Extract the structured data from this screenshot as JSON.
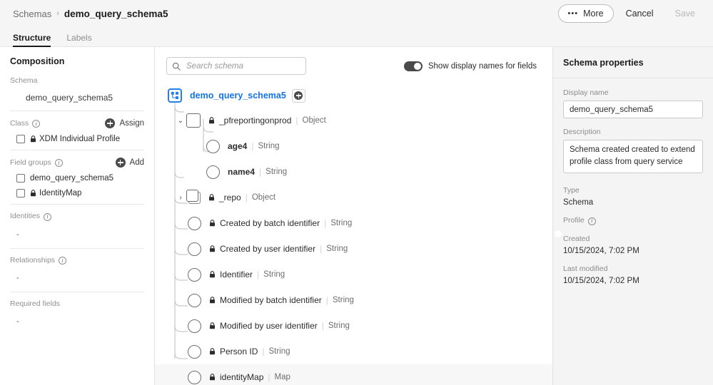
{
  "header": {
    "breadcrumb": {
      "root": "Schemas",
      "separator": "›",
      "current": "demo_query_schema5"
    },
    "more_label": "More",
    "cancel_label": "Cancel",
    "save_label": "Save"
  },
  "tabs": [
    {
      "label": "Structure",
      "active": true
    },
    {
      "label": "Labels",
      "active": false
    }
  ],
  "sidebar": {
    "title": "Composition",
    "schema": {
      "label": "Schema",
      "value": "demo_query_schema5"
    },
    "class": {
      "label": "Class",
      "action": "Assign",
      "items": [
        {
          "label": "XDM Individual Profile",
          "locked": true
        }
      ]
    },
    "field_groups": {
      "label": "Field groups",
      "action": "Add",
      "items": [
        {
          "label": "demo_query_schema5",
          "locked": false
        },
        {
          "label": "IdentityMap",
          "locked": true
        }
      ]
    },
    "identities": {
      "label": "Identities",
      "value": "-"
    },
    "relationships": {
      "label": "Relationships",
      "value": "-"
    },
    "required_fields": {
      "label": "Required fields",
      "value": "-"
    }
  },
  "center": {
    "search_placeholder": "Search schema",
    "search_value": "",
    "toggle_label": "Show display names for fields",
    "toggle_on": true,
    "root": {
      "name": "demo_query_schema5",
      "icon": "schema-root-icon"
    },
    "rows": [
      {
        "name": "_pfreportingonprod",
        "type": "Object",
        "node": "square",
        "indent": 1,
        "locked": true,
        "expanded": true,
        "chevron": "down"
      },
      {
        "name": "age4",
        "type": "String",
        "node": "circle",
        "indent": 2,
        "locked": false,
        "chevron": ""
      },
      {
        "name": "name4",
        "type": "String",
        "node": "circle",
        "indent": 2,
        "locked": false,
        "chevron": ""
      },
      {
        "name": "_repo",
        "type": "Object",
        "node": "stack",
        "indent": 1,
        "locked": true,
        "expanded": false,
        "chevron": "right"
      },
      {
        "name": "Created by batch identifier",
        "type": "String",
        "node": "circle",
        "indent": 1,
        "locked": true,
        "chevron": ""
      },
      {
        "name": "Created by user identifier",
        "type": "String",
        "node": "circle",
        "indent": 1,
        "locked": true,
        "chevron": ""
      },
      {
        "name": "Identifier",
        "type": "String",
        "node": "circle",
        "indent": 1,
        "locked": true,
        "chevron": ""
      },
      {
        "name": "Modified by batch identifier",
        "type": "String",
        "node": "circle",
        "indent": 1,
        "locked": true,
        "chevron": ""
      },
      {
        "name": "Modified by user identifier",
        "type": "String",
        "node": "circle",
        "indent": 1,
        "locked": true,
        "chevron": ""
      },
      {
        "name": "Person ID",
        "type": "String",
        "node": "circle",
        "indent": 1,
        "locked": true,
        "chevron": ""
      },
      {
        "name": "identityMap",
        "type": "Map",
        "node": "circle",
        "indent": 1,
        "locked": true,
        "chevron": "",
        "highlighted": true
      }
    ]
  },
  "properties": {
    "title": "Schema properties",
    "display_name": {
      "label": "Display name",
      "value": "demo_query_schema5"
    },
    "description": {
      "label": "Description",
      "value": "Schema created created to extend profile class from query service"
    },
    "type": {
      "label": "Type",
      "value": "Schema"
    },
    "profile": {
      "label": "Profile",
      "enabled": true
    },
    "created": {
      "label": "Created",
      "value": "10/15/2024, 7:02 PM"
    },
    "last_modified": {
      "label": "Last modified",
      "value": "10/15/2024, 7:02 PM"
    }
  },
  "colors": {
    "accent": "#1473e6",
    "root_badge": "#2680eb",
    "panel_bg": "#f4f4f4",
    "toggle_on": "#4a4a4a"
  }
}
